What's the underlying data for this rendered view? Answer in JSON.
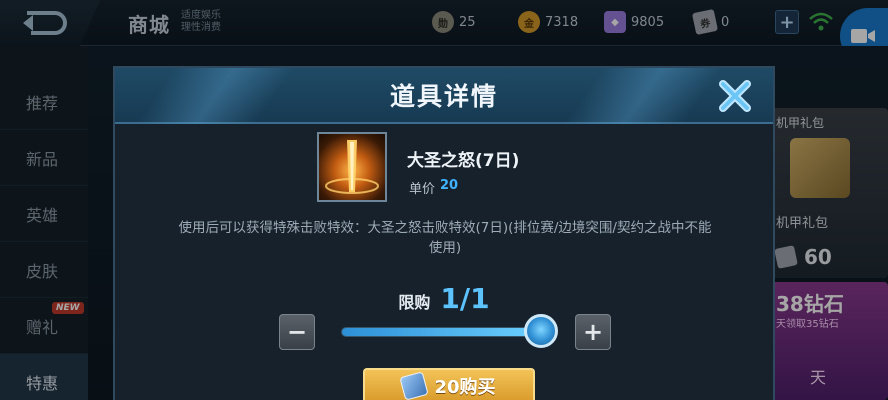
{
  "topbar": {
    "title": "商城",
    "subtitle": "适度娱乐\n理性消费",
    "currencies": [
      {
        "icon": "medal-coin-icon",
        "value": "25",
        "color": "#8d8a7c"
      },
      {
        "icon": "gold-coin-icon",
        "value": "7318",
        "color": "#d49a2a"
      },
      {
        "icon": "diamond-icon",
        "value": "9805",
        "color": "#9a7de0"
      },
      {
        "icon": "voucher-icon",
        "value": "0",
        "color": "#a3aab2"
      }
    ],
    "plus_label": "+"
  },
  "sidebar": {
    "items": [
      {
        "label": "推荐"
      },
      {
        "label": "新品"
      },
      {
        "label": "英雄"
      },
      {
        "label": "皮肤"
      },
      {
        "label": "赠礼",
        "badge": "NEW"
      },
      {
        "label": "特惠"
      }
    ],
    "active_index": 5
  },
  "background": {
    "card_a_label": "机甲礼包",
    "card_a_name": "机甲礼包",
    "card_a_price": "60",
    "card_b_title": "38钻石",
    "card_b_sub": "天领取35钻石",
    "card_b_footer": "天"
  },
  "modal": {
    "title": "道具详情",
    "item_name": "大圣之怒(7日)",
    "price_label": "单价",
    "price_value": "20",
    "description": "使用后可以获得特殊击败特效：大圣之怒击败特效(7日)(排位赛/边境突围/契约之战中不能使用)",
    "limit_label": "限购",
    "limit_value": "1/1",
    "quantity_fraction": 1.0,
    "minus_label": "−",
    "plus_label": "+",
    "buy_label": "20购买"
  }
}
